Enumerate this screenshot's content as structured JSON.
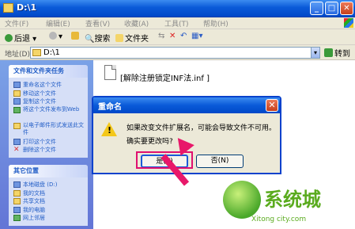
{
  "window": {
    "title": "D:\\1"
  },
  "menubar": {
    "items": [
      "文件(F)",
      "编辑(E)",
      "查看(V)",
      "收藏(A)",
      "工具(T)",
      "帮助(H)"
    ]
  },
  "toolbar": {
    "back": "后退",
    "search": "搜索",
    "folders": "文件夹"
  },
  "address": {
    "label": "地址(D)",
    "value": "D:\\1",
    "go": "转到"
  },
  "taskpane": {
    "file_tasks": {
      "title": "文件和文件夹任务",
      "items": [
        "重命名这个文件",
        "移动这个文件",
        "复制这个文件",
        "将这个文件发布到Web",
        "以电子邮件形式发送此文件",
        "打印这个文件",
        "删除这个文件"
      ]
    },
    "other_places": {
      "title": "其它位置",
      "items": [
        "本地磁盘 (D:)",
        "我的文档",
        "共享文档",
        "我的电脑",
        "网上邻居"
      ]
    }
  },
  "main": {
    "file_name": "[解除注册锁定INF法.inf ]"
  },
  "dialog": {
    "title": "重命名",
    "message_line1": "如果改变文件扩展名，可能会导致文件不可用。",
    "message_line2": "确实要更改吗?",
    "yes": "是(Y)",
    "no": "否(N)"
  },
  "watermark": {
    "brand": "系统城",
    "url": "Xitong city.com"
  },
  "colors": {
    "titlebar": "#0a5ad8",
    "taskpane": "#6e8ee0",
    "highlight": "#e01070",
    "watermark": "#5aab1e"
  }
}
